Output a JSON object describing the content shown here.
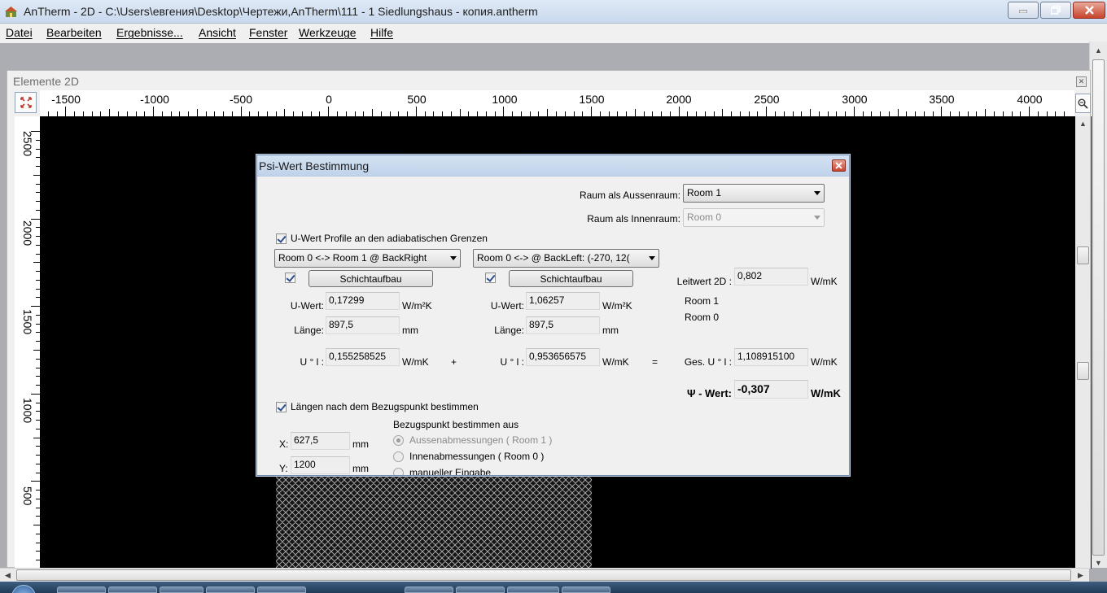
{
  "window": {
    "title": "AnTherm - 2D - C:\\Users\\евгения\\Desktop\\Чертежи,AnTherm\\111 - 1 Siedlungshaus - копия.antherm"
  },
  "menu": [
    "Datei",
    "Bearbeiten",
    "Ergebnisse...",
    "Ansicht",
    "Fenster",
    "Werkzeuge",
    "Hilfe"
  ],
  "child": {
    "title": "Elemente 2D",
    "ruler_h": [
      "-1500",
      "-1000",
      "-500",
      "0",
      "500",
      "1000",
      "1500",
      "2000",
      "2500",
      "3000",
      "3500",
      "4000"
    ],
    "ruler_v": [
      "2500",
      "2000",
      "1500",
      "1000",
      "500"
    ]
  },
  "dialog": {
    "title": "Psi-Wert Bestimmung",
    "raum_aussen_label": "Raum als Aussenraum:",
    "raum_aussen_value": "Room 1",
    "raum_innen_label": "Raum als Innenraum:",
    "raum_innen_value": "Room 0",
    "uwert_profile_label": "U-Wert Profile an den adiabatischen Grenzen",
    "profile_left": "Room 0 <-> Room 1 @ BackRight",
    "profile_right": "Room 0 <->  @ BackLeft: (-270, 12(",
    "left": {
      "button": "Schichtaufbau",
      "uwert_label": "U-Wert:",
      "uwert": "0,17299",
      "uwert_unit": "W/m²K",
      "laenge_label": "Länge:",
      "laenge": "897,5",
      "laenge_unit": "mm",
      "ul_label": "U ° l :",
      "ul": "0,155258525",
      "ul_unit": "W/mK"
    },
    "right": {
      "button": "Schichtaufbau",
      "uwert_label": "U-Wert:",
      "uwert": "1,06257",
      "uwert_unit": "W/m²K",
      "laenge_label": "Länge:",
      "laenge": "897,5",
      "laenge_unit": "mm",
      "ul_label": "U ° l :",
      "ul": "0,953656575",
      "ul_unit": "W/mK"
    },
    "plus": "+",
    "equals": "=",
    "leitwert_label": "Leitwert 2D :",
    "leitwert": "0,802",
    "leitwert_unit": "W/mK",
    "room1": "Room 1",
    "room0": "Room 0",
    "ges_label": "Ges. U ° l :",
    "ges": "1,108915100",
    "ges_unit": "W/mK",
    "psi_label": "Ψ - Wert:",
    "psi": "-0,307",
    "psi_unit": "W/mK",
    "laengen_label": "Längen nach dem Bezugspunkt bestimmen",
    "x_label": "X:",
    "x": "627,5",
    "y_label": "Y:",
    "y": "1200",
    "xy_unit": "mm",
    "bezug_title": "Bezugspunkt bestimmen aus",
    "radio": [
      "Aussenabmessungen ( Room 1 )",
      "Innenabmessungen ( Room 0 )",
      "manueller Eingabe"
    ]
  },
  "colors": {
    "canvas": "#000000",
    "titlebar": "#c9d9ee",
    "close_red": "#c7432b"
  }
}
